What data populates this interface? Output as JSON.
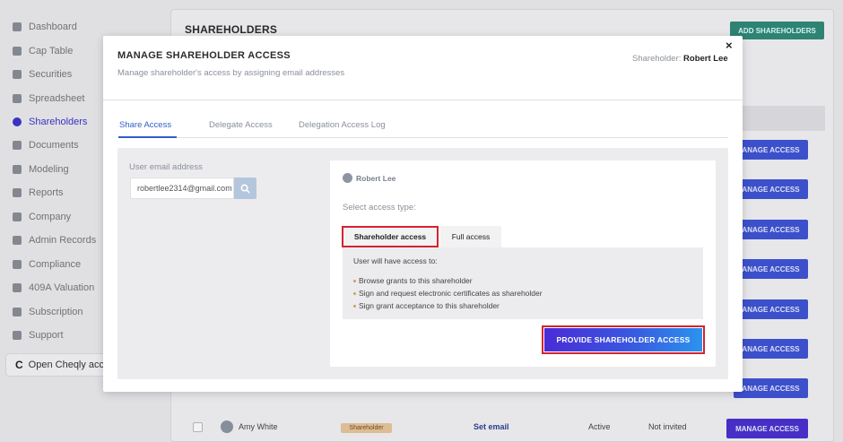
{
  "sidebar": {
    "items": [
      {
        "label": "Dashboard",
        "icon": "dashboard-icon"
      },
      {
        "label": "Cap Table",
        "icon": "pie-chart-icon"
      },
      {
        "label": "Securities",
        "icon": "securities-icon"
      },
      {
        "label": "Spreadsheet",
        "icon": "spreadsheet-icon"
      },
      {
        "label": "Shareholders",
        "icon": "person-icon"
      },
      {
        "label": "Documents",
        "icon": "folder-icon"
      },
      {
        "label": "Modeling",
        "icon": "bulb-icon"
      },
      {
        "label": "Reports",
        "icon": "report-icon"
      },
      {
        "label": "Company",
        "icon": "building-icon"
      },
      {
        "label": "Admin Records",
        "icon": "records-icon"
      },
      {
        "label": "Compliance",
        "icon": "shield-icon"
      },
      {
        "label": "409A Valuation",
        "icon": "valuation-icon"
      },
      {
        "label": "Subscription",
        "icon": "dollar-icon"
      },
      {
        "label": "Support",
        "icon": "support-icon"
      }
    ],
    "open_cheqly": "Open Cheqly acco",
    "active": "Shareholders"
  },
  "background": {
    "title": "SHAREHOLDERS",
    "add_button": "ADD SHAREHOLDERS",
    "manage_label": "MANAGE ACCESS",
    "partial_manage_label": "ANAGE ACCESS",
    "visible_row": {
      "name": "Amy White",
      "role": "Shareholder",
      "email": "Set email",
      "status": "Active",
      "invite": "Not invited"
    }
  },
  "modal": {
    "title": "MANAGE SHAREHOLDER ACCESS",
    "subtitle": "Manage shareholder's access by assigning email addresses",
    "shareholder_prefix": "Shareholder:",
    "shareholder_name": "Robert Lee",
    "close": "×",
    "tabs": [
      "Share Access",
      "Delegate Access",
      "Delegation Access Log"
    ],
    "email_label": "User email address",
    "email_value": "robertlee2314@gmail.com",
    "card": {
      "user": "Robert Lee",
      "select_label": "Select access type:",
      "types": [
        "Shareholder access",
        "Full access"
      ],
      "intro": "User will have access to:",
      "bullets": [
        "Browse grants to this shareholder",
        "Sign and request electronic certificates as shareholder",
        "Sign grant acceptance to this shareholder"
      ],
      "submit": "PROVIDE SHAREHOLDER ACCESS"
    }
  },
  "colors": {
    "accent": "#3b35c9",
    "tab_active": "#2f5ec9",
    "highlight": "#d3242f",
    "green_button": "#2f8a78"
  }
}
